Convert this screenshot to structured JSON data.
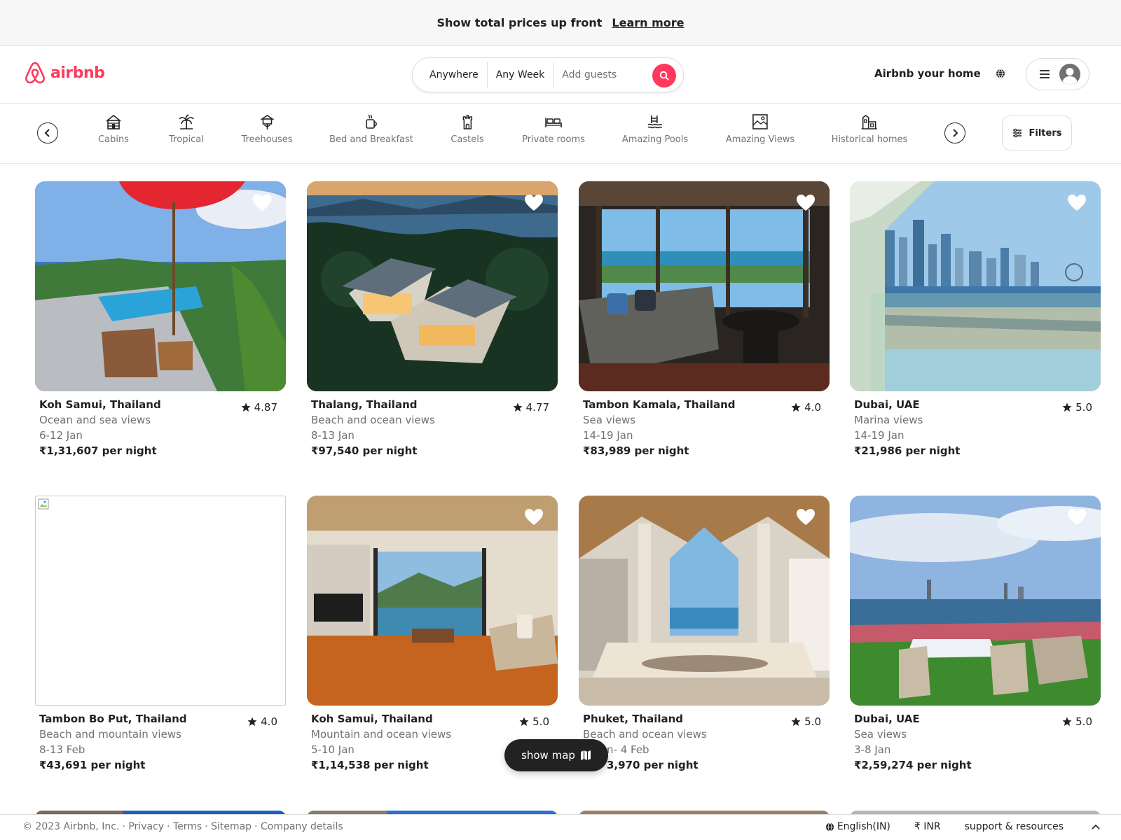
{
  "banner": {
    "text": "Show total prices up front",
    "link": "Learn more"
  },
  "header": {
    "logo_text": "airbnb",
    "search": {
      "where": "Anywhere",
      "when": "Any Week",
      "guests": "Add guests"
    },
    "host_link": "Airbnb your home"
  },
  "categories": [
    "Cabins",
    "Tropical",
    "Treehouses",
    "Bed and Breakfast",
    "Castels",
    "Private rooms",
    "Amazing Pools",
    "Amazing Views",
    "Historical homes"
  ],
  "filters_label": "Filters",
  "listings": [
    {
      "title": "Koh Samui, Thailand",
      "subtitle": "Ocean and sea views",
      "dates": "6-12 Jan",
      "price": "₹1,31,607 per night",
      "rating": "4.87"
    },
    {
      "title": "Thalang, Thailand",
      "subtitle": "Beach and ocean views",
      "dates": "8-13 Jan",
      "price": "₹97,540 per night",
      "rating": "4.77"
    },
    {
      "title": "Tambon Kamala, Thailand",
      "subtitle": "Sea views",
      "dates": "14-19 Jan",
      "price": "₹83,989 per night",
      "rating": "4.0"
    },
    {
      "title": "Dubai, UAE",
      "subtitle": "Marina views",
      "dates": "14-19 Jan",
      "price": "₹21,986 per night",
      "rating": "5.0"
    },
    {
      "title": "Tambon Bo Put, Thailand",
      "subtitle": "Beach and mountain views",
      "dates": "8-13 Feb",
      "price": "₹43,691 per night",
      "rating": "4.0"
    },
    {
      "title": "Koh Samui, Thailand",
      "subtitle": "Mountain and ocean views",
      "dates": "5-10 Jan",
      "price": "₹1,14,538 per night",
      "rating": "5.0"
    },
    {
      "title": "Phuket, Thailand",
      "subtitle": "Beach and ocean views",
      "dates": "n- 4 Feb",
      "price": "3,970 per night",
      "rating": "5.0"
    },
    {
      "title": "Dubai, UAE",
      "subtitle": "Sea views",
      "dates": "3-8 Jan",
      "price": "₹2,59,274 per night",
      "rating": "5.0"
    }
  ],
  "show_map": "show map",
  "footer": {
    "copyright": "© 2023 Airbnb, Inc.",
    "links": [
      "· Privacy",
      "· Terms",
      "· Sitemap",
      "· Company details"
    ],
    "language": "English(IN)",
    "currency": "₹ INR",
    "support": "support & resources"
  },
  "colors": {
    "brand": "#FF385C",
    "text": "#222222",
    "muted": "#717171"
  }
}
